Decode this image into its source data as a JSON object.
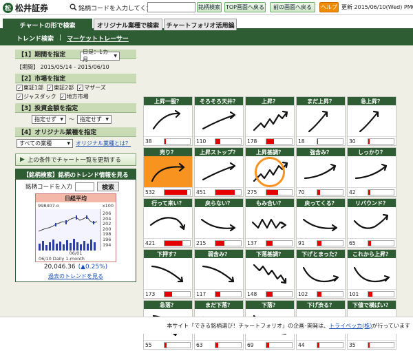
{
  "header": {
    "brand": "松井証券",
    "search_label": "銘柄コードを入力してください",
    "search_button": "銘柄検索",
    "top_button": "TOP画面へ戻る",
    "back_button": "前の画面へ戻る",
    "help_button": "ヘルプ",
    "updated": "更新 2015/06/10(Wed) PM0"
  },
  "tabs": [
    "チャートの形で検索",
    "オリジナル業種で検索",
    "チャートフォリオ活用編"
  ],
  "subnav": [
    "トレンド検索",
    "|",
    "マーケットトレーサー"
  ],
  "filters": {
    "s1": "【1】期間を指定",
    "period_select": "日足：1カ月",
    "period_text": "【期間】 2015/05/14 - 2015/06/10",
    "s2": "【2】市場を指定",
    "markets": [
      {
        "label": "東証1部",
        "checked": true
      },
      {
        "label": "東証2部",
        "checked": true
      },
      {
        "label": "マザーズ",
        "checked": true
      },
      {
        "label": "ジャスダック",
        "checked": true
      },
      {
        "label": "地方市場",
        "checked": true
      }
    ],
    "s3": "【3】投資金額を指定",
    "amount_from": "指定せず",
    "amount_sep": "～",
    "amount_to": "指定せず",
    "s4": "【4】オリジナル業種を指定",
    "industry_select": "すべての業種",
    "industry_link": "オリジナル業種とは？",
    "run_button": "上の条件でチャート一覧を更新する"
  },
  "stockbox": {
    "title": "【銘柄検索】銘柄のトレンド情報を見る",
    "code_label": "銘柄コードを入力",
    "search_button": "検索",
    "index_title": "日経平均",
    "index_left": "998407.o",
    "index_right": "x100",
    "yticks": [
      "206",
      "204",
      "202",
      "200",
      "198",
      "196",
      "194"
    ],
    "date_tick": "06/01",
    "footer": "06/10 Daily 1-month",
    "value": "20,046.36",
    "change": "(▲0.25%)",
    "past_link": "過去のトレンドを見る"
  },
  "cells": [
    {
      "label": "上昇一服？",
      "count": "38",
      "ratio": 0.06,
      "shape": "peak"
    },
    {
      "label": "そろそろ天井？",
      "count": "110",
      "ratio": 0.18,
      "shape": "rise"
    },
    {
      "label": "上昇？",
      "count": "178",
      "ratio": 0.3,
      "shape": "zigup"
    },
    {
      "label": "まだ上昇？",
      "count": "18",
      "ratio": 0.03,
      "shape": "steep"
    },
    {
      "label": "急上昇？",
      "count": "30",
      "ratio": 0.05,
      "shape": "steep"
    },
    {
      "label": "売り？",
      "count": "532",
      "ratio": 0.9,
      "shape": "arc",
      "highlight": true
    },
    {
      "label": "上昇ストップ？",
      "count": "451",
      "ratio": 0.76,
      "shape": "rise"
    },
    {
      "label": "上昇基調？",
      "count": "275",
      "ratio": 0.46,
      "shape": "zigup",
      "ring": true
    },
    {
      "label": "強含み？",
      "count": "70",
      "ratio": 0.12,
      "shape": "flatup"
    },
    {
      "label": "しっかり？",
      "count": "42",
      "ratio": 0.07,
      "shape": "flatup"
    },
    {
      "label": "行って来い？",
      "count": "421",
      "ratio": 0.71,
      "shape": "hump"
    },
    {
      "label": "戻らない？",
      "count": "215",
      "ratio": 0.36,
      "shape": "dip"
    },
    {
      "label": "もみ合い？",
      "count": "137",
      "ratio": 0.23,
      "shape": "zigflat"
    },
    {
      "label": "戻ってくる？",
      "count": "91",
      "ratio": 0.15,
      "shape": "dip"
    },
    {
      "label": "リバウンド？",
      "count": "65",
      "ratio": 0.11,
      "shape": "bounce"
    },
    {
      "label": "下押す？",
      "count": "173",
      "ratio": 0.29,
      "shape": "fall"
    },
    {
      "label": "弱含み？",
      "count": "117",
      "ratio": 0.2,
      "shape": "fall"
    },
    {
      "label": "下落基調？",
      "count": "148",
      "ratio": 0.25,
      "shape": "zigdown"
    },
    {
      "label": "下げとまった？",
      "count": "102",
      "ratio": 0.17,
      "shape": "bottom"
    },
    {
      "label": "これから上昇？",
      "count": "101",
      "ratio": 0.17,
      "shape": "bottom"
    },
    {
      "label": "急落？",
      "count": "55",
      "ratio": 0.09,
      "shape": "plunge"
    },
    {
      "label": "まだ下落？",
      "count": "63",
      "ratio": 0.11,
      "shape": "fall"
    },
    {
      "label": "下落？",
      "count": "69",
      "ratio": 0.12,
      "shape": "zigdown"
    },
    {
      "label": "下げ渋る？",
      "count": "44",
      "ratio": 0.07,
      "shape": "bottom"
    },
    {
      "label": "下値で横ばい？",
      "count": "35",
      "ratio": 0.06,
      "shape": "bottom"
    }
  ],
  "footer": {
    "text": "本サイト「できる銘柄選び！チャートフォリオ」の企画･開発は、",
    "link": "トライベッカ(株)",
    "tail": "が行っています"
  }
}
